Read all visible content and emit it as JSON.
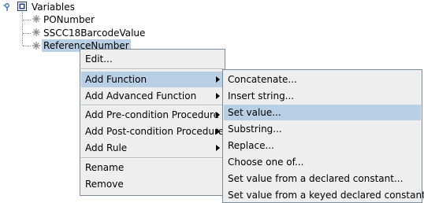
{
  "tree": {
    "root": {
      "label": "Variables",
      "icon": "variables-icon",
      "expanded": true
    },
    "children": [
      {
        "label": "PONumber",
        "icon": "variable-icon",
        "selected": false
      },
      {
        "label": "SSCC18BarcodeValue",
        "icon": "variable-icon",
        "selected": false
      },
      {
        "label": "ReferenceNumber",
        "icon": "variable-icon",
        "selected": true
      }
    ]
  },
  "context_menu": {
    "items": [
      {
        "label": "Edit...",
        "has_submenu": false,
        "highlighted": false
      },
      {
        "label": "Add Function",
        "has_submenu": true,
        "highlighted": true
      },
      {
        "label": "Add Advanced Function",
        "has_submenu": true,
        "highlighted": false
      },
      {
        "label": "Add Pre-condition Procedure",
        "has_submenu": true,
        "highlighted": false
      },
      {
        "label": "Add Post-condition Procedure",
        "has_submenu": true,
        "highlighted": false
      },
      {
        "label": "Add Rule",
        "has_submenu": true,
        "highlighted": false
      },
      {
        "label": "Rename",
        "has_submenu": false,
        "highlighted": false
      },
      {
        "label": "Remove",
        "has_submenu": false,
        "highlighted": false
      }
    ]
  },
  "submenu": {
    "items": [
      {
        "label": "Concatenate...",
        "highlighted": false
      },
      {
        "label": "Insert string...",
        "highlighted": false
      },
      {
        "label": "Set value...",
        "highlighted": true
      },
      {
        "label": "Substring...",
        "highlighted": false
      },
      {
        "label": "Replace...",
        "highlighted": false
      },
      {
        "label": "Choose one of...",
        "highlighted": false
      },
      {
        "label": "Set value from a declared constant...",
        "highlighted": false
      },
      {
        "label": "Set value from a keyed declared constant...",
        "highlighted": false
      }
    ]
  },
  "colors": {
    "selection": "#b8cfe5",
    "menu_bg": "#eeeeee",
    "menu_border": "#7a8a99"
  }
}
